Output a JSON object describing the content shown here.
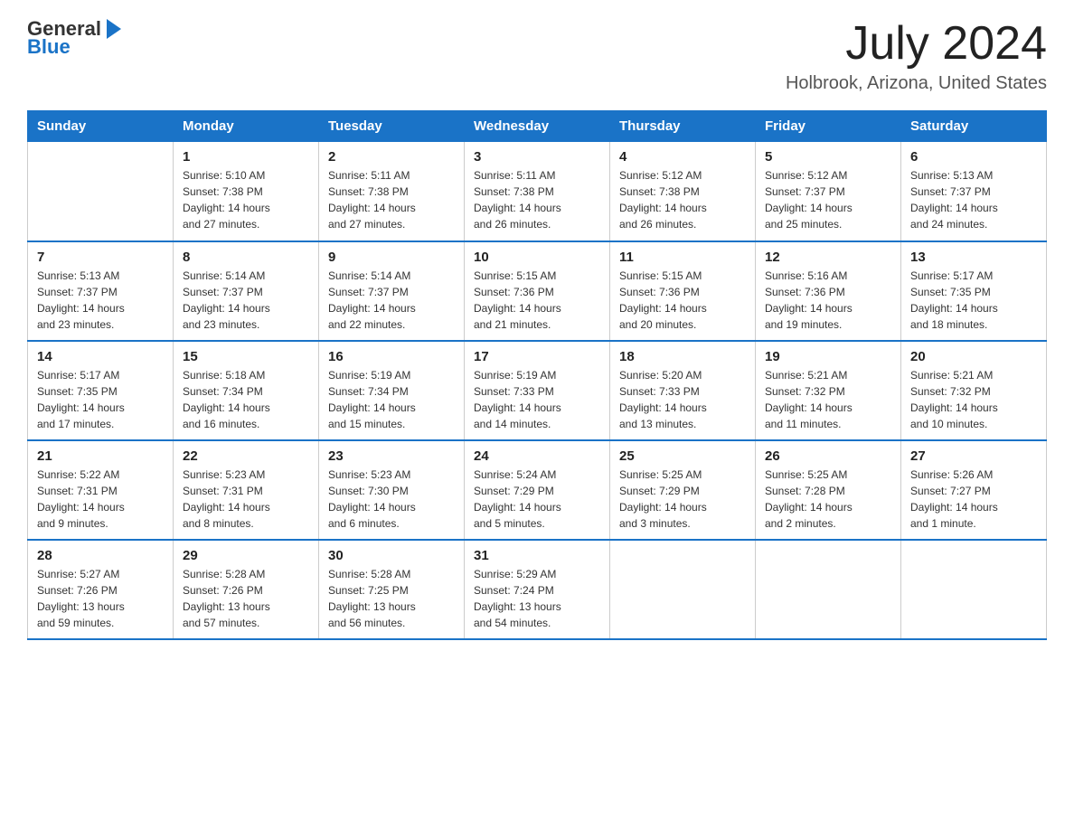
{
  "logo": {
    "text_general": "General",
    "text_blue": "Blue"
  },
  "title": "July 2024",
  "subtitle": "Holbrook, Arizona, United States",
  "days_of_week": [
    "Sunday",
    "Monday",
    "Tuesday",
    "Wednesday",
    "Thursday",
    "Friday",
    "Saturday"
  ],
  "weeks": [
    [
      {
        "day": "",
        "info": ""
      },
      {
        "day": "1",
        "info": "Sunrise: 5:10 AM\nSunset: 7:38 PM\nDaylight: 14 hours\nand 27 minutes."
      },
      {
        "day": "2",
        "info": "Sunrise: 5:11 AM\nSunset: 7:38 PM\nDaylight: 14 hours\nand 27 minutes."
      },
      {
        "day": "3",
        "info": "Sunrise: 5:11 AM\nSunset: 7:38 PM\nDaylight: 14 hours\nand 26 minutes."
      },
      {
        "day": "4",
        "info": "Sunrise: 5:12 AM\nSunset: 7:38 PM\nDaylight: 14 hours\nand 26 minutes."
      },
      {
        "day": "5",
        "info": "Sunrise: 5:12 AM\nSunset: 7:37 PM\nDaylight: 14 hours\nand 25 minutes."
      },
      {
        "day": "6",
        "info": "Sunrise: 5:13 AM\nSunset: 7:37 PM\nDaylight: 14 hours\nand 24 minutes."
      }
    ],
    [
      {
        "day": "7",
        "info": "Sunrise: 5:13 AM\nSunset: 7:37 PM\nDaylight: 14 hours\nand 23 minutes."
      },
      {
        "day": "8",
        "info": "Sunrise: 5:14 AM\nSunset: 7:37 PM\nDaylight: 14 hours\nand 23 minutes."
      },
      {
        "day": "9",
        "info": "Sunrise: 5:14 AM\nSunset: 7:37 PM\nDaylight: 14 hours\nand 22 minutes."
      },
      {
        "day": "10",
        "info": "Sunrise: 5:15 AM\nSunset: 7:36 PM\nDaylight: 14 hours\nand 21 minutes."
      },
      {
        "day": "11",
        "info": "Sunrise: 5:15 AM\nSunset: 7:36 PM\nDaylight: 14 hours\nand 20 minutes."
      },
      {
        "day": "12",
        "info": "Sunrise: 5:16 AM\nSunset: 7:36 PM\nDaylight: 14 hours\nand 19 minutes."
      },
      {
        "day": "13",
        "info": "Sunrise: 5:17 AM\nSunset: 7:35 PM\nDaylight: 14 hours\nand 18 minutes."
      }
    ],
    [
      {
        "day": "14",
        "info": "Sunrise: 5:17 AM\nSunset: 7:35 PM\nDaylight: 14 hours\nand 17 minutes."
      },
      {
        "day": "15",
        "info": "Sunrise: 5:18 AM\nSunset: 7:34 PM\nDaylight: 14 hours\nand 16 minutes."
      },
      {
        "day": "16",
        "info": "Sunrise: 5:19 AM\nSunset: 7:34 PM\nDaylight: 14 hours\nand 15 minutes."
      },
      {
        "day": "17",
        "info": "Sunrise: 5:19 AM\nSunset: 7:33 PM\nDaylight: 14 hours\nand 14 minutes."
      },
      {
        "day": "18",
        "info": "Sunrise: 5:20 AM\nSunset: 7:33 PM\nDaylight: 14 hours\nand 13 minutes."
      },
      {
        "day": "19",
        "info": "Sunrise: 5:21 AM\nSunset: 7:32 PM\nDaylight: 14 hours\nand 11 minutes."
      },
      {
        "day": "20",
        "info": "Sunrise: 5:21 AM\nSunset: 7:32 PM\nDaylight: 14 hours\nand 10 minutes."
      }
    ],
    [
      {
        "day": "21",
        "info": "Sunrise: 5:22 AM\nSunset: 7:31 PM\nDaylight: 14 hours\nand 9 minutes."
      },
      {
        "day": "22",
        "info": "Sunrise: 5:23 AM\nSunset: 7:31 PM\nDaylight: 14 hours\nand 8 minutes."
      },
      {
        "day": "23",
        "info": "Sunrise: 5:23 AM\nSunset: 7:30 PM\nDaylight: 14 hours\nand 6 minutes."
      },
      {
        "day": "24",
        "info": "Sunrise: 5:24 AM\nSunset: 7:29 PM\nDaylight: 14 hours\nand 5 minutes."
      },
      {
        "day": "25",
        "info": "Sunrise: 5:25 AM\nSunset: 7:29 PM\nDaylight: 14 hours\nand 3 minutes."
      },
      {
        "day": "26",
        "info": "Sunrise: 5:25 AM\nSunset: 7:28 PM\nDaylight: 14 hours\nand 2 minutes."
      },
      {
        "day": "27",
        "info": "Sunrise: 5:26 AM\nSunset: 7:27 PM\nDaylight: 14 hours\nand 1 minute."
      }
    ],
    [
      {
        "day": "28",
        "info": "Sunrise: 5:27 AM\nSunset: 7:26 PM\nDaylight: 13 hours\nand 59 minutes."
      },
      {
        "day": "29",
        "info": "Sunrise: 5:28 AM\nSunset: 7:26 PM\nDaylight: 13 hours\nand 57 minutes."
      },
      {
        "day": "30",
        "info": "Sunrise: 5:28 AM\nSunset: 7:25 PM\nDaylight: 13 hours\nand 56 minutes."
      },
      {
        "day": "31",
        "info": "Sunrise: 5:29 AM\nSunset: 7:24 PM\nDaylight: 13 hours\nand 54 minutes."
      },
      {
        "day": "",
        "info": ""
      },
      {
        "day": "",
        "info": ""
      },
      {
        "day": "",
        "info": ""
      }
    ]
  ]
}
